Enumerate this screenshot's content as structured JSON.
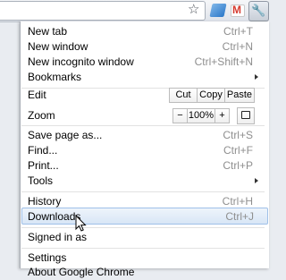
{
  "toolbar": {
    "icons": [
      "star-icon",
      "note-extension-icon",
      "gmail-extension-icon",
      "wrench-menu-icon"
    ]
  },
  "menu": {
    "new_tab": {
      "label": "New tab",
      "shortcut": "Ctrl+T"
    },
    "new_window": {
      "label": "New window",
      "shortcut": "Ctrl+N"
    },
    "new_incognito": {
      "label": "New incognito window",
      "shortcut": "Ctrl+Shift+N"
    },
    "bookmarks": {
      "label": "Bookmarks"
    },
    "edit": {
      "label": "Edit",
      "cut": "Cut",
      "copy": "Copy",
      "paste": "Paste"
    },
    "zoom": {
      "label": "Zoom",
      "minus": "−",
      "value": "100%",
      "plus": "+"
    },
    "save_page": {
      "label": "Save page as...",
      "shortcut": "Ctrl+S"
    },
    "find": {
      "label": "Find...",
      "shortcut": "Ctrl+F"
    },
    "print": {
      "label": "Print...",
      "shortcut": "Ctrl+P"
    },
    "tools": {
      "label": "Tools"
    },
    "history": {
      "label": "History",
      "shortcut": "Ctrl+H"
    },
    "downloads": {
      "label": "Downloads",
      "shortcut": "Ctrl+J",
      "highlighted": true
    },
    "signed_in": {
      "label": "Signed in as"
    },
    "settings": {
      "label": "Settings"
    },
    "about": {
      "label": "About Google Chrome"
    }
  }
}
